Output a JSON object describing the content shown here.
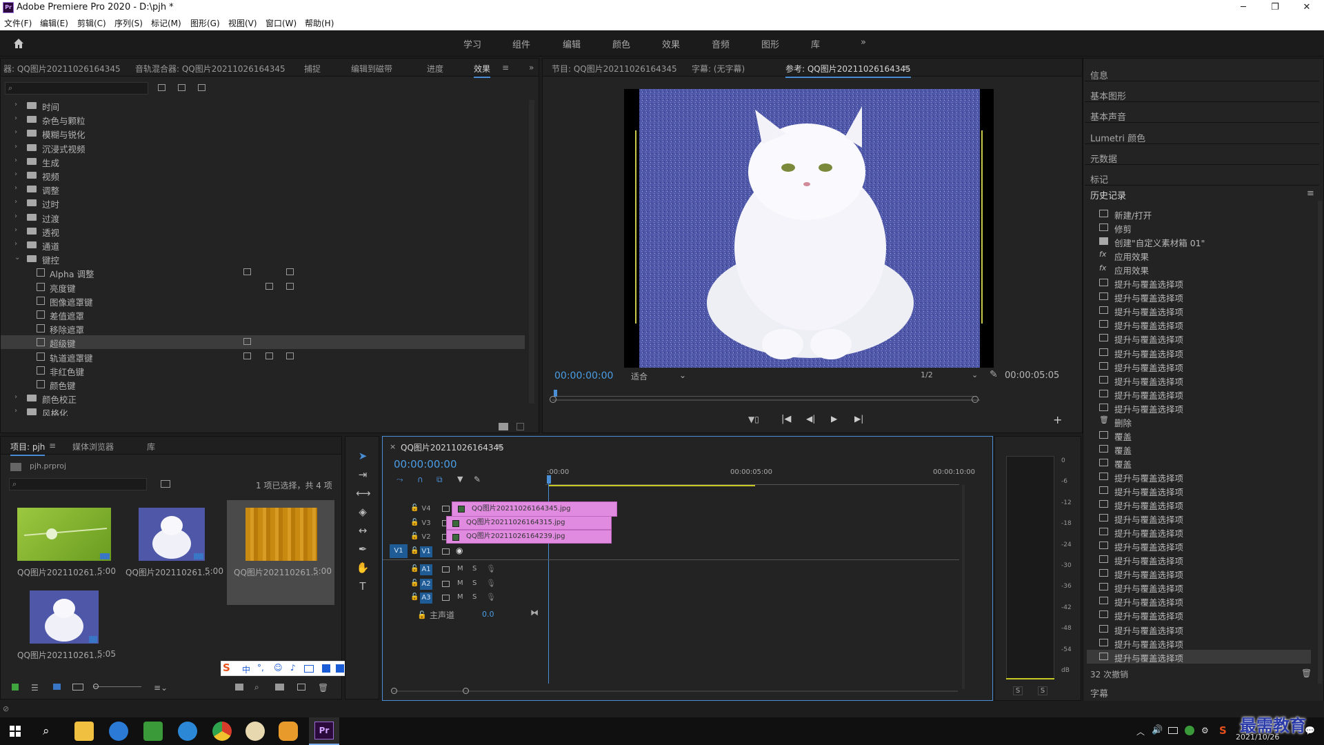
{
  "window": {
    "title": "Adobe Premiere Pro 2020 - D:\\pjh *",
    "app_icon": "Pr"
  },
  "menu": [
    "文件(F)",
    "编辑(E)",
    "剪辑(C)",
    "序列(S)",
    "标记(M)",
    "图形(G)",
    "视图(V)",
    "窗口(W)",
    "帮助(H)"
  ],
  "workspaces": [
    "学习",
    "组件",
    "编辑",
    "颜色",
    "效果",
    "音频",
    "图形",
    "库"
  ],
  "left_panel": {
    "tabs": [
      "器: QQ图片20211026164345",
      "音轨混合器: QQ图片20211026164345",
      "捕捉",
      "编辑到磁带",
      "进度",
      "效果"
    ],
    "tree": [
      {
        "label": "时间",
        "type": "folder"
      },
      {
        "label": "杂色与颗粒",
        "type": "folder"
      },
      {
        "label": "模糊与锐化",
        "type": "folder"
      },
      {
        "label": "沉浸式视频",
        "type": "folder"
      },
      {
        "label": "生成",
        "type": "folder"
      },
      {
        "label": "视频",
        "type": "folder"
      },
      {
        "label": "调整",
        "type": "folder"
      },
      {
        "label": "过时",
        "type": "folder"
      },
      {
        "label": "过渡",
        "type": "folder"
      },
      {
        "label": "透视",
        "type": "folder"
      },
      {
        "label": "通道",
        "type": "folder"
      },
      {
        "label": "键控",
        "type": "folder",
        "expanded": true
      },
      {
        "label": "Alpha 调整",
        "type": "effect"
      },
      {
        "label": "亮度键",
        "type": "effect"
      },
      {
        "label": "图像遮罩键",
        "type": "effect"
      },
      {
        "label": "差值遮罩",
        "type": "effect"
      },
      {
        "label": "移除遮罩",
        "type": "effect"
      },
      {
        "label": "超级键",
        "type": "effect",
        "selected": true
      },
      {
        "label": "轨道遮罩键",
        "type": "effect"
      },
      {
        "label": "非红色键",
        "type": "effect"
      },
      {
        "label": "颜色键",
        "type": "effect"
      },
      {
        "label": "颜色校正",
        "type": "folder"
      },
      {
        "label": "风格化",
        "type": "folder"
      }
    ]
  },
  "program": {
    "tabs": [
      "节目: QQ图片20211026164345",
      "字幕: (无字幕)",
      "参考: QQ图片20211026164345"
    ],
    "timecode": "00:00:00:00",
    "fit": "适合",
    "res": "1/2",
    "duration": "00:00:05:05"
  },
  "right_panel": {
    "items": [
      "信息",
      "基本图形",
      "基本声音",
      "Lumetri 颜色",
      "元数据",
      "标记"
    ],
    "history_title": "历史记录",
    "history": [
      {
        "label": "新建/打开",
        "icon": "doc-icon"
      },
      {
        "label": "修剪",
        "icon": "trim-icon"
      },
      {
        "label": "创建\"自定义素材箱 01\"",
        "icon": "folder-icon"
      },
      {
        "label": "应用效果",
        "icon": "fx-icon"
      },
      {
        "label": "应用效果",
        "icon": "fx-icon"
      },
      {
        "label": "提升与覆盖选择项",
        "icon": "doc-icon"
      },
      {
        "label": "提升与覆盖选择项",
        "icon": "doc-icon"
      },
      {
        "label": "提升与覆盖选择项",
        "icon": "doc-icon"
      },
      {
        "label": "提升与覆盖选择项",
        "icon": "doc-icon"
      },
      {
        "label": "提升与覆盖选择项",
        "icon": "doc-icon"
      },
      {
        "label": "提升与覆盖选择项",
        "icon": "doc-icon"
      },
      {
        "label": "提升与覆盖选择项",
        "icon": "doc-icon"
      },
      {
        "label": "提升与覆盖选择项",
        "icon": "doc-icon"
      },
      {
        "label": "提升与覆盖选择项",
        "icon": "doc-icon"
      },
      {
        "label": "提升与覆盖选择项",
        "icon": "doc-icon"
      },
      {
        "label": "删除",
        "icon": "trash-icon"
      },
      {
        "label": "覆盖",
        "icon": "doc-icon"
      },
      {
        "label": "覆盖",
        "icon": "doc-icon"
      },
      {
        "label": "覆盖",
        "icon": "doc-icon"
      },
      {
        "label": "提升与覆盖选择项",
        "icon": "doc-icon"
      },
      {
        "label": "提升与覆盖选择项",
        "icon": "doc-icon"
      },
      {
        "label": "提升与覆盖选择项",
        "icon": "doc-icon"
      },
      {
        "label": "提升与覆盖选择项",
        "icon": "doc-icon"
      },
      {
        "label": "提升与覆盖选择项",
        "icon": "doc-icon"
      },
      {
        "label": "提升与覆盖选择项",
        "icon": "doc-icon"
      },
      {
        "label": "提升与覆盖选择项",
        "icon": "doc-icon"
      },
      {
        "label": "提升与覆盖选择项",
        "icon": "doc-icon"
      },
      {
        "label": "提升与覆盖选择项",
        "icon": "doc-icon"
      },
      {
        "label": "提升与覆盖选择项",
        "icon": "doc-icon"
      },
      {
        "label": "提升与覆盖选择项",
        "icon": "doc-icon"
      },
      {
        "label": "提升与覆盖选择项",
        "icon": "doc-icon"
      },
      {
        "label": "提升与覆盖选择项",
        "icon": "doc-icon"
      },
      {
        "label": "提升与覆盖选择项",
        "icon": "doc-icon"
      }
    ],
    "undo_count": "32 次撤销",
    "captions": "字幕"
  },
  "project": {
    "tabs": [
      "项目: pjh",
      "媒体浏览器",
      "库"
    ],
    "file": "pjh.prproj",
    "selection_info": "1 项已选择，共 4 项",
    "items": [
      {
        "name": "QQ图片202110261...",
        "duration": "5:00",
        "kind": "green"
      },
      {
        "name": "QQ图片202110261...",
        "duration": "5:00",
        "kind": "cat"
      },
      {
        "name": "QQ图片202110261...",
        "duration": "5:00",
        "kind": "wood"
      },
      {
        "name": "QQ图片202110261...",
        "duration": "5:05",
        "kind": "cat"
      }
    ]
  },
  "timeline": {
    "tab": "QQ图片20211026164345",
    "timecode": "00:00:00:00",
    "ruler": [
      ":00:00",
      "00:00:05:00",
      "00:00:10:00"
    ],
    "video_tracks": [
      "V4",
      "V3",
      "V2",
      "V1"
    ],
    "audio_tracks": [
      "A1",
      "A2",
      "A3"
    ],
    "master_label": "主声道",
    "master_value": "0.0",
    "clips": [
      {
        "track": "V4",
        "name": "QQ图片20211026164345.jpg"
      },
      {
        "track": "V3",
        "name": "QQ图片20211026164315.jpg"
      },
      {
        "track": "V2",
        "name": "QQ图片20211026164239.jpg"
      }
    ]
  },
  "meter": {
    "scale": [
      "0",
      "-6",
      "-12",
      "-18",
      "-24",
      "-30",
      "-36",
      "-42",
      "-48",
      "-54",
      "dB"
    ],
    "buttons": [
      "S",
      "S"
    ]
  },
  "ime": {
    "label": "中"
  },
  "taskbar": {
    "date": "2021/10/26",
    "watermark": "最需教育"
  }
}
